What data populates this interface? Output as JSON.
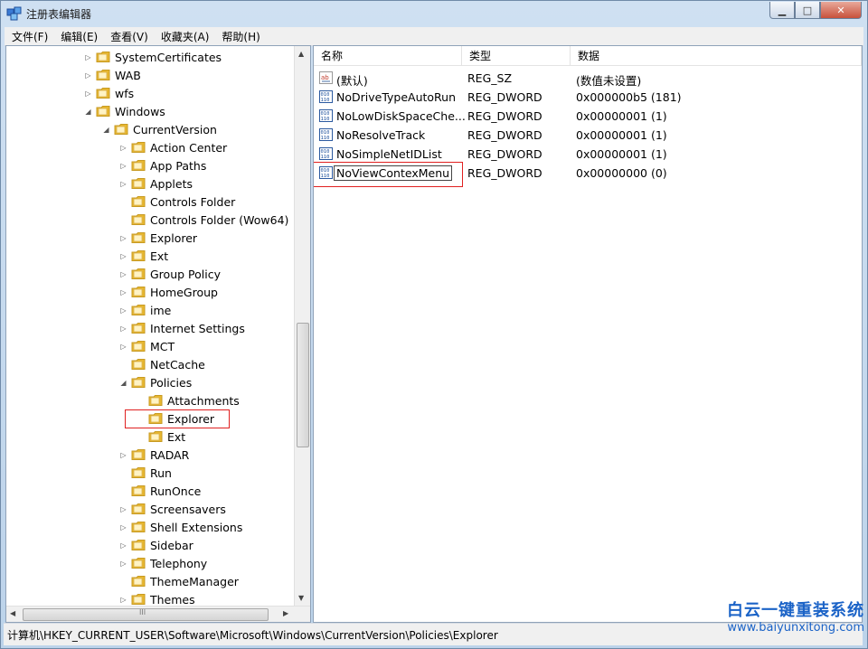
{
  "window": {
    "title": "注册表编辑器",
    "min_glyph": "▁",
    "max_glyph": "□",
    "close_glyph": "✕"
  },
  "menu": [
    "文件(F)",
    "编辑(E)",
    "查看(V)",
    "收藏夹(A)",
    "帮助(H)"
  ],
  "tree": [
    {
      "label": "SystemCertificates",
      "level": 0,
      "expander": "▷"
    },
    {
      "label": "WAB",
      "level": 0,
      "expander": "▷"
    },
    {
      "label": "wfs",
      "level": 0,
      "expander": "▷"
    },
    {
      "label": "Windows",
      "level": 0,
      "expander": "◢"
    },
    {
      "label": "CurrentVersion",
      "level": 1,
      "expander": "◢"
    },
    {
      "label": "Action Center",
      "level": 2,
      "expander": "▷"
    },
    {
      "label": "App Paths",
      "level": 2,
      "expander": "▷"
    },
    {
      "label": "Applets",
      "level": 2,
      "expander": "▷"
    },
    {
      "label": "Controls Folder",
      "level": 2,
      "expander": ""
    },
    {
      "label": "Controls Folder (Wow64)",
      "level": 2,
      "expander": ""
    },
    {
      "label": "Explorer",
      "level": 2,
      "expander": "▷"
    },
    {
      "label": "Ext",
      "level": 2,
      "expander": "▷"
    },
    {
      "label": "Group Policy",
      "level": 2,
      "expander": "▷"
    },
    {
      "label": "HomeGroup",
      "level": 2,
      "expander": "▷"
    },
    {
      "label": "ime",
      "level": 2,
      "expander": "▷"
    },
    {
      "label": "Internet Settings",
      "level": 2,
      "expander": "▷"
    },
    {
      "label": "MCT",
      "level": 2,
      "expander": "▷"
    },
    {
      "label": "NetCache",
      "level": 2,
      "expander": ""
    },
    {
      "label": "Policies",
      "level": 2,
      "expander": "◢"
    },
    {
      "label": "Attachments",
      "level": 3,
      "expander": ""
    },
    {
      "label": "Explorer",
      "level": 3,
      "expander": "",
      "selected": true
    },
    {
      "label": "Ext",
      "level": 3,
      "expander": ""
    },
    {
      "label": "RADAR",
      "level": 2,
      "expander": "▷"
    },
    {
      "label": "Run",
      "level": 2,
      "expander": ""
    },
    {
      "label": "RunOnce",
      "level": 2,
      "expander": ""
    },
    {
      "label": "Screensavers",
      "level": 2,
      "expander": "▷"
    },
    {
      "label": "Shell Extensions",
      "level": 2,
      "expander": "▷"
    },
    {
      "label": "Sidebar",
      "level": 2,
      "expander": "▷"
    },
    {
      "label": "Telephony",
      "level": 2,
      "expander": "▷"
    },
    {
      "label": "ThemeManager",
      "level": 2,
      "expander": ""
    },
    {
      "label": "Themes",
      "level": 2,
      "expander": "▷"
    }
  ],
  "tree_scroll": {
    "up": "▲",
    "down": "▼",
    "left": "◀",
    "right": "▶",
    "grip": "III"
  },
  "list": {
    "columns": [
      "名称",
      "类型",
      "数据"
    ],
    "rows": [
      {
        "name": "(默认)",
        "type": "REG_SZ",
        "data": "(数值未设置)",
        "icon": "string-value-icon"
      },
      {
        "name": "NoDriveTypeAutoRun",
        "type": "REG_DWORD",
        "data": "0x000000b5 (181)",
        "icon": "binary-value-icon"
      },
      {
        "name": "NoLowDiskSpaceChe...",
        "type": "REG_DWORD",
        "data": "0x00000001 (1)",
        "icon": "binary-value-icon"
      },
      {
        "name": "NoResolveTrack",
        "type": "REG_DWORD",
        "data": "0x00000001 (1)",
        "icon": "binary-value-icon"
      },
      {
        "name": "NoSimpleNetIDList",
        "type": "REG_DWORD",
        "data": "0x00000001 (1)",
        "icon": "binary-value-icon"
      },
      {
        "name": "NoViewContexMenu",
        "type": "REG_DWORD",
        "data": "0x00000000 (0)",
        "icon": "binary-value-icon",
        "editing": true
      }
    ]
  },
  "status": {
    "path": "计算机\\HKEY_CURRENT_USER\\Software\\Microsoft\\Windows\\CurrentVersion\\Policies\\Explorer"
  },
  "watermark": {
    "line1": "白云一键重装系统",
    "line2": "www.baiyunxitong.com"
  },
  "colors": {
    "highlight_box": "#e02020",
    "watermark": "#1b63c7",
    "folder": "#e8b830"
  }
}
